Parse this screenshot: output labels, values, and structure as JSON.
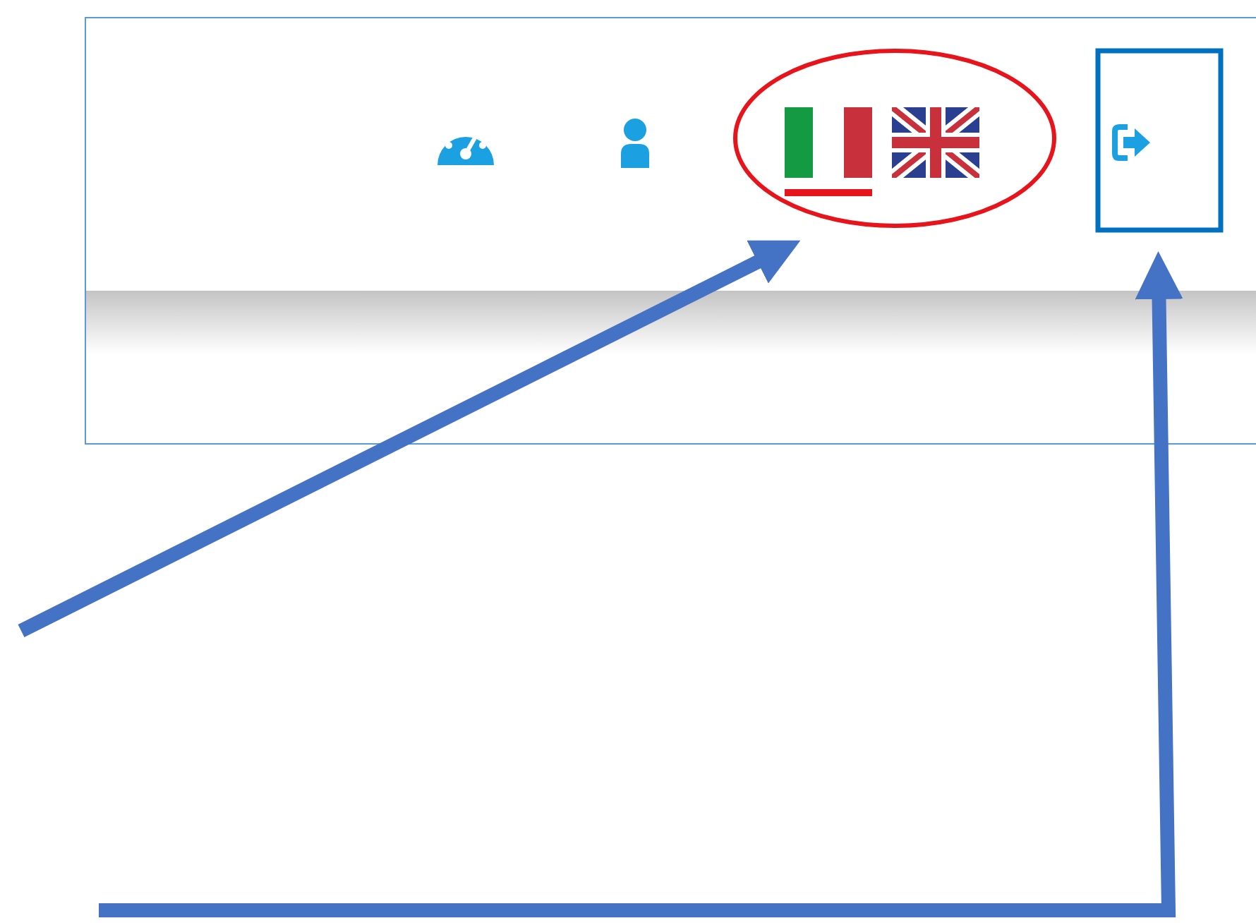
{
  "header": {
    "languages": [
      {
        "kind": "italian",
        "selected": true
      },
      {
        "kind": "british",
        "selected": false
      }
    ]
  }
}
